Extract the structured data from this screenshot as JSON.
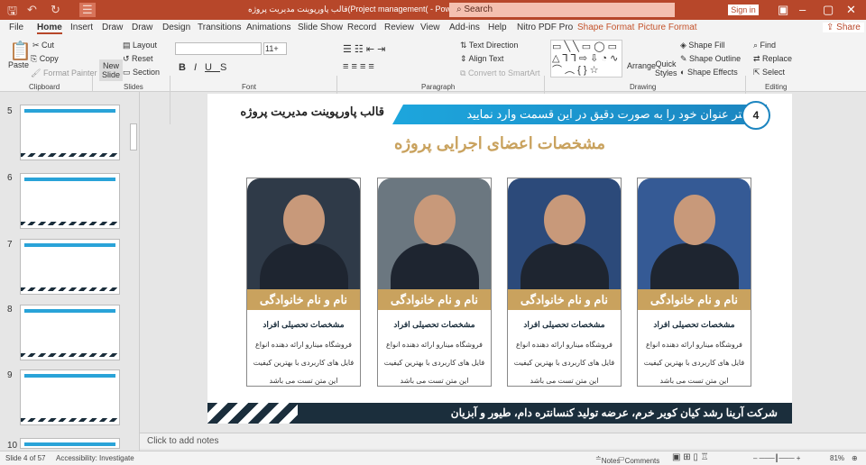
{
  "titlebar": {
    "doc_title": "قالب پاورپوینت مدیریت پروژه(Project management(  -  PowerPoint",
    "search_placeholder": "Search",
    "sign_in": "Sign in",
    "share": "Share"
  },
  "tabs": [
    "File",
    "Home",
    "Insert",
    "Draw",
    "Draw",
    "Design",
    "Transitions",
    "Animations",
    "Slide Show",
    "Record",
    "Review",
    "View",
    "Add-ins",
    "Help",
    "Nitro PDF Pro",
    "Shape Format",
    "Picture Format"
  ],
  "ribbon": {
    "paste": "Paste",
    "cut": "Cut",
    "copy": "Copy",
    "format_painter": "Format Painter",
    "new_slide": "New Slide",
    "layout": "Layout",
    "reset": "Reset",
    "section": "Section",
    "font_size": "11+",
    "text_direction": "Text Direction",
    "align_text": "Align Text",
    "convert_smartart": "Convert to SmartArt",
    "arrange": "Arrange",
    "quick_styles": "Quick Styles",
    "shape_fill": "Shape Fill",
    "shape_outline": "Shape Outline",
    "shape_effects": "Shape Effects",
    "find": "Find",
    "replace": "Replace",
    "select": "Select",
    "groups": {
      "clipboard": "Clipboard",
      "slides": "Slides",
      "font": "Font",
      "paragraph": "Paragraph",
      "drawing": "Drawing",
      "editing": "Editing"
    }
  },
  "thumbnails": [
    "5",
    "6",
    "7",
    "8",
    "9",
    "10"
  ],
  "slide": {
    "header_left": "قالب پاورپوینت مدیریت پروژه",
    "header_title": "تیتر عنوان خود را به صورت دقیق در این قسمت وارد نمایید",
    "page_number": "4",
    "subtitle": "مشخصات اعضای اجرایی پروژه",
    "cards": [
      {
        "name": "نام و نام خانوادگی",
        "education": "مشخصات تحصیلی افراد",
        "description": "فروشگاه مینارو ارائه دهنده انواع فایل های کاربردی با بهترین کیفیت این متن تست می باشد",
        "photo_bg": "#2f3a48"
      },
      {
        "name": "نام و نام خانوادگی",
        "education": "مشخصات تحصیلی افراد",
        "description": "فروشگاه مینارو ارائه دهنده انواع فایل های کاربردی با بهترین کیفیت این متن تست می باشد",
        "photo_bg": "#6b7780"
      },
      {
        "name": "نام و نام خانوادگی",
        "education": "مشخصات تحصیلی افراد",
        "description": "فروشگاه مینارو ارائه دهنده انواع فایل های کاربردی با بهترین کیفیت این متن تست می باشد",
        "photo_bg": "#2c4a7a"
      },
      {
        "name": "نام و نام خانوادگی",
        "education": "مشخصات تحصیلی افراد",
        "description": "فروشگاه مینارو ارائه دهنده انواع فایل های کاربردی با بهترین کیفیت این متن تست می باشد",
        "photo_bg": "#355a95"
      }
    ],
    "footer": "شرکت آرینا رشد کیان کویر خرم، عرضه تولید کنسانتره دام، طیور و آبزیان"
  },
  "notes_placeholder": "Click to add notes",
  "status": {
    "slide_info": "Slide 4 of 57",
    "accessibility": "Accessibility: Investigate",
    "notes": "Notes",
    "comments": "Comments",
    "zoom": "81%"
  }
}
